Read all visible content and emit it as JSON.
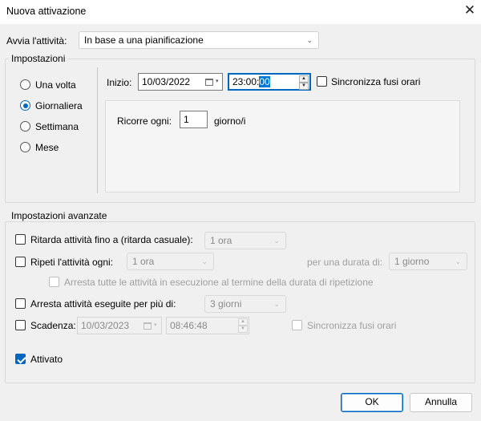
{
  "window": {
    "title": "Nuova attivazione",
    "close_glyph": "✕"
  },
  "start_task": {
    "label": "Avvia l'attività:",
    "value": "In base a una pianificazione"
  },
  "settings": {
    "group_title": "Impostazioni",
    "radios": [
      {
        "label": "Una volta",
        "checked": false
      },
      {
        "label": "Giornaliera",
        "checked": true
      },
      {
        "label": "Settimana",
        "checked": false
      },
      {
        "label": "Mese",
        "checked": false
      }
    ],
    "start_label": "Inizio:",
    "start_date": "10/03/2022",
    "start_time_prefix": "23:00:",
    "start_time_selected": "00",
    "sync_tz_label": "Sincronizza fusi orari",
    "recur_label": "Ricorre ogni:",
    "recur_value": "1",
    "recur_unit": "giorno/i"
  },
  "advanced": {
    "group_title": "Impostazioni avanzate",
    "delay_label": "Ritarda attività fino a (ritarda casuale):",
    "delay_value": "1 ora",
    "repeat_label": "Ripeti l'attività ogni:",
    "repeat_value": "1 ora",
    "duration_label": "per una durata di:",
    "duration_value": "1 giorno",
    "stop_all_label": "Arresta tutte le attività in esecuzione al termine della durata di ripetizione",
    "stop_longer_label": "Arresta attività eseguite per più di:",
    "stop_longer_value": "3 giorni",
    "expire_label": "Scadenza:",
    "expire_date": "10/03/2023",
    "expire_time": "08:46:48",
    "expire_sync_label": "Sincronizza fusi orari",
    "enabled_label": "Attivato"
  },
  "buttons": {
    "ok": "OK",
    "cancel": "Annulla"
  },
  "colors": {
    "accent": "#0067c0",
    "selection": "#0078d7"
  }
}
